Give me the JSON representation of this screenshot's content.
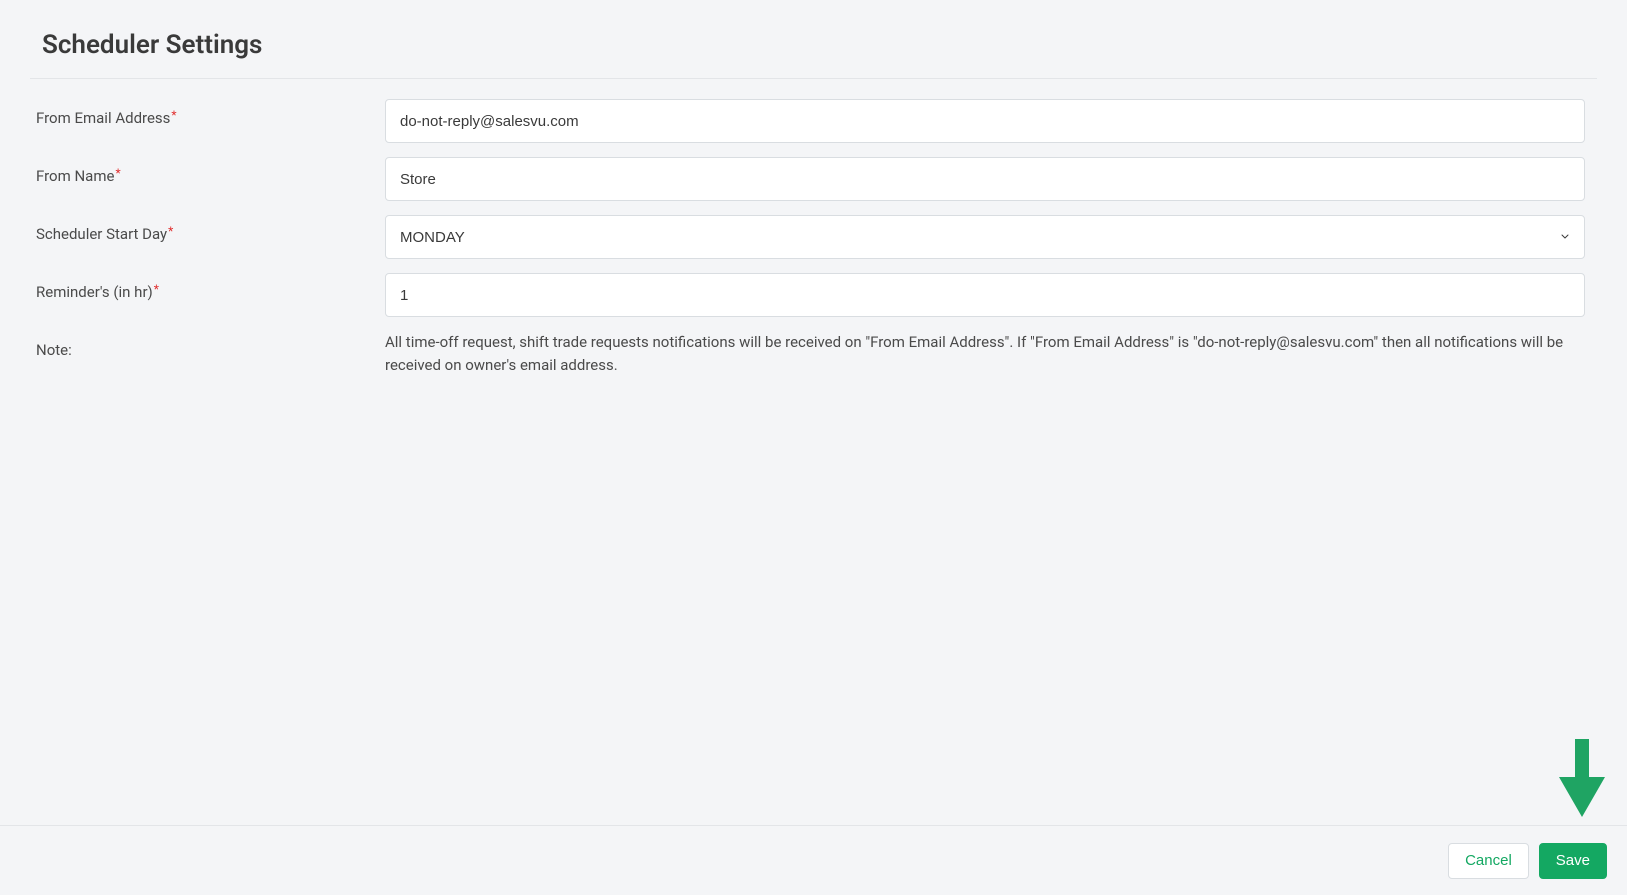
{
  "page": {
    "title": "Scheduler Settings"
  },
  "form": {
    "from_email": {
      "label": "From Email Address",
      "required": true,
      "value": "do-not-reply@salesvu.com"
    },
    "from_name": {
      "label": "From Name",
      "required": true,
      "value": "Store"
    },
    "start_day": {
      "label": "Scheduler Start Day",
      "required": true,
      "value": "MONDAY"
    },
    "reminders": {
      "label": "Reminder's (in hr)",
      "required": true,
      "value": "1"
    },
    "note": {
      "label": "Note:",
      "text": "All time-off request, shift trade requests notifications will be received on \"From Email Address\". If \"From Email Address\" is \"do-not-reply@salesvu.com\" then all notifications will be received on owner's email address."
    }
  },
  "footer": {
    "cancel_label": "Cancel",
    "save_label": "Save"
  }
}
